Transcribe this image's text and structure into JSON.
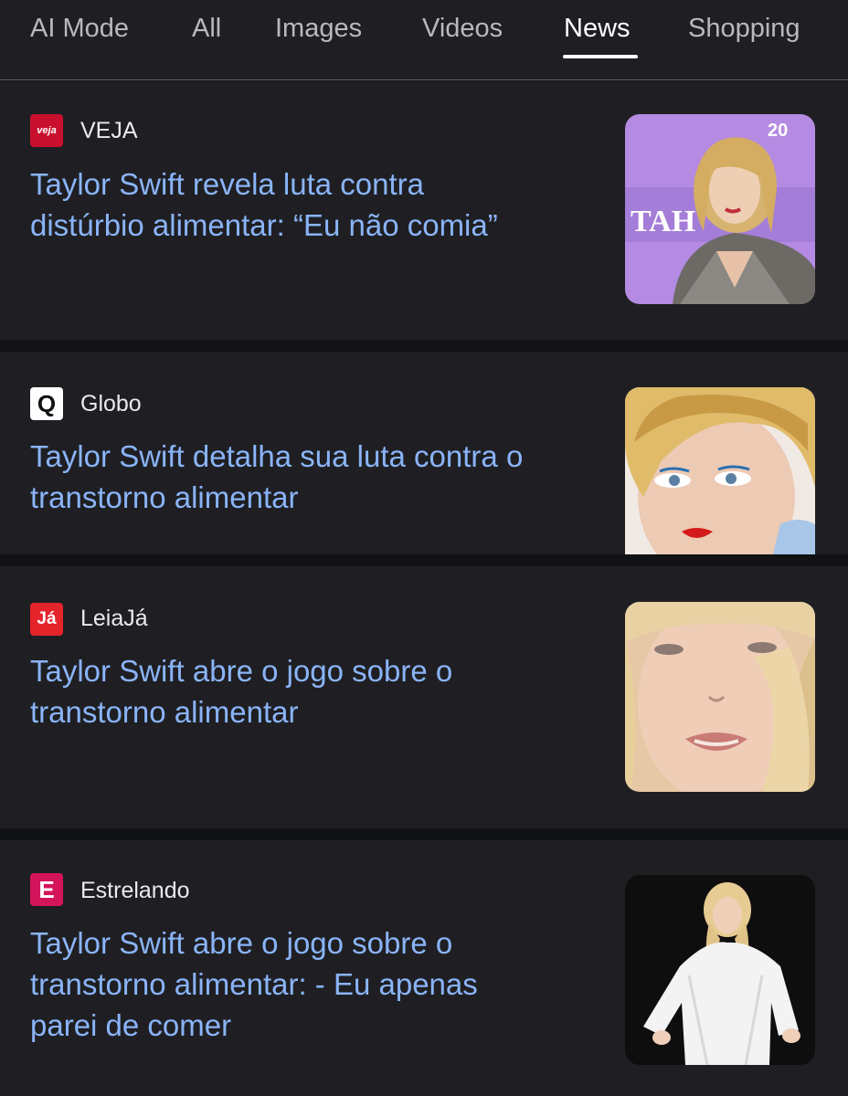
{
  "tabs": [
    {
      "label": "AI Mode",
      "active": false
    },
    {
      "label": "All",
      "active": false
    },
    {
      "label": "Images",
      "active": false
    },
    {
      "label": "Videos",
      "active": false
    },
    {
      "label": "News",
      "active": true
    },
    {
      "label": "Shopping",
      "active": false
    }
  ],
  "articles": [
    {
      "source": "VEJA",
      "logo_text": "veja",
      "logo_color": "#c8102e",
      "headline": "Taylor Swift revela luta contra\ndistúrbio alimentar: “Eu não comia”",
      "thumb_backdrop_text": "TAH",
      "thumb_corner_text": "20"
    },
    {
      "source": "Globo",
      "logo_text": "Q",
      "logo_color": "#ffffff",
      "headline": "Taylor Swift detalha sua luta contra o\ntranstorno alimentar"
    },
    {
      "source": "LeiaJá",
      "logo_text": "Já",
      "logo_color": "#e5232b",
      "headline": "Taylor Swift abre o jogo sobre o\ntranstorno alimentar"
    },
    {
      "source": "Estrelando",
      "logo_text": "E",
      "logo_color": "#d4145a",
      "headline": "Taylor Swift abre o jogo sobre o\ntranstorno alimentar: - Eu apenas\nparei de comer"
    }
  ],
  "colors": {
    "background": "#1f1f23",
    "separator": "#111214",
    "headline": "#8ab4f8",
    "tab_inactive": "#b7b9bf",
    "tab_active": "#ffffff"
  }
}
